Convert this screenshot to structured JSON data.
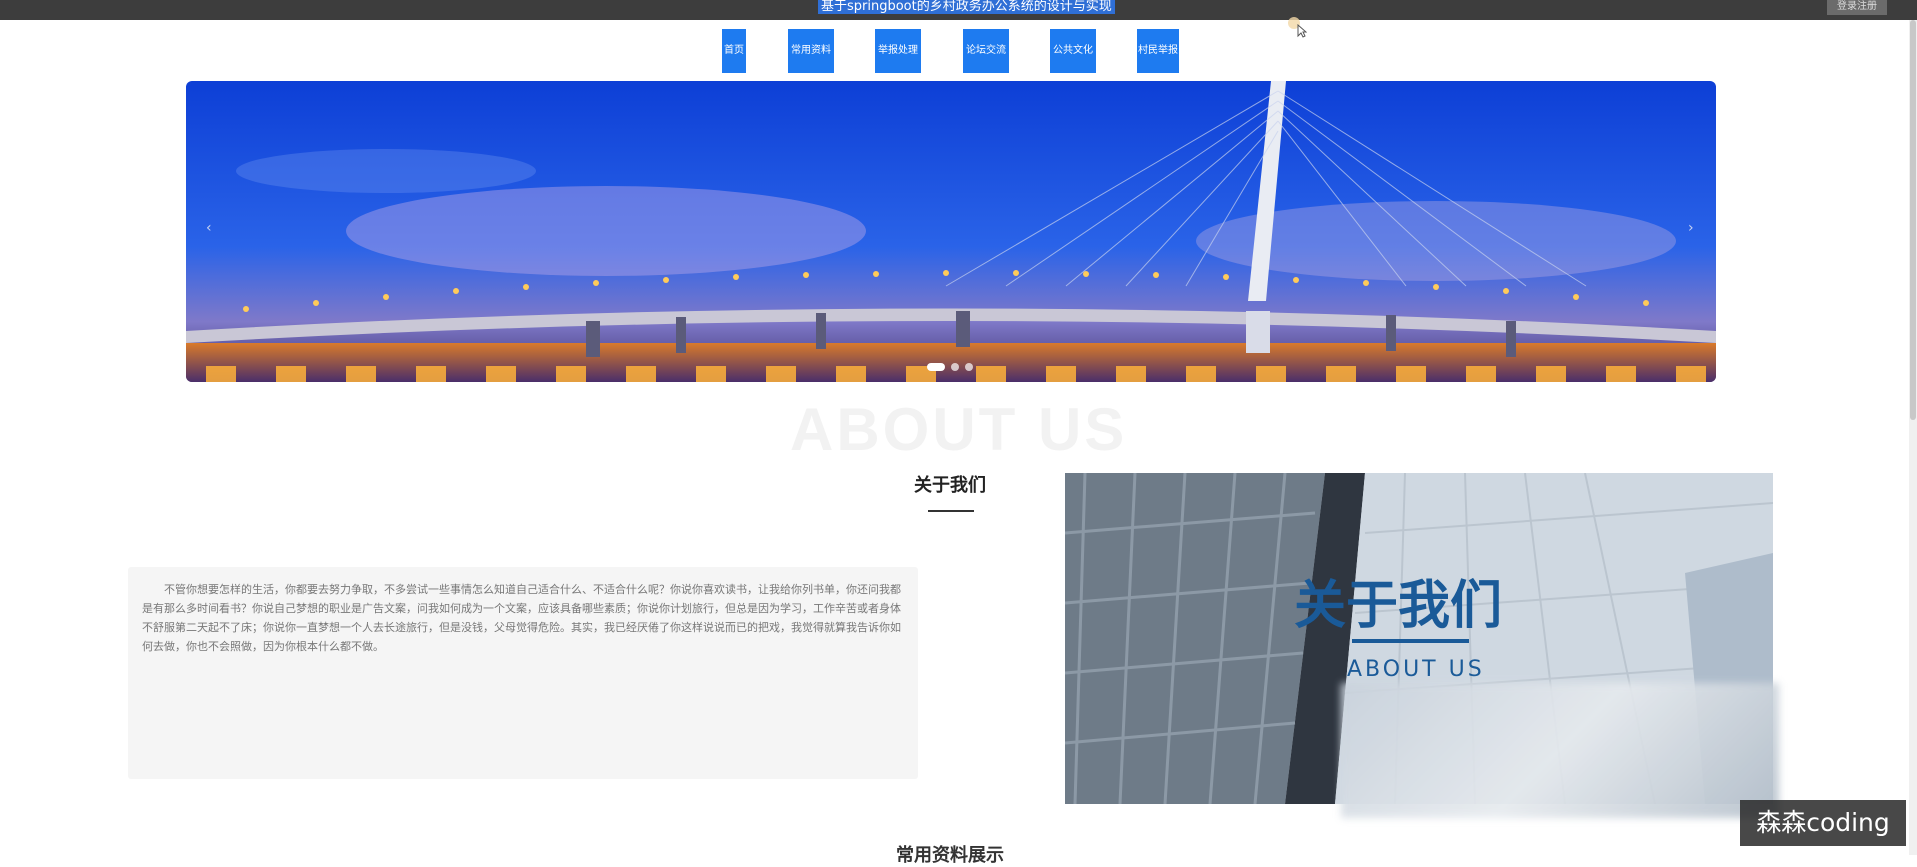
{
  "header": {
    "title": "基于springboot的乡村政务办公系统的设计与实现",
    "login_label": "登录注册"
  },
  "nav": {
    "items": [
      {
        "label": "首页"
      },
      {
        "label": "常用资料"
      },
      {
        "label": "举报处理"
      },
      {
        "label": "论坛交流"
      },
      {
        "label": "公共文化"
      },
      {
        "label": "村民举报"
      }
    ]
  },
  "carousel": {
    "prev_label": "‹",
    "next_label": "›",
    "slide_count": 3,
    "active_index": 0
  },
  "about": {
    "background_title": "ABOUT US",
    "title": "关于我们",
    "body": "不管你想要怎样的生活，你都要去努力争取，不多尝试一些事情怎么知道自己适合什么、不适合什么呢？你说你喜欢读书，让我给你列书单，你还问我都是有那么多时间看书？你说自己梦想的职业是广告文案，问我如何成为一个文案，应该具备哪些素质；你说你计划旅行，但总是因为学习，工作辛苦或者身体不舒服第二天起不了床；你说你一直梦想一个人去长途旅行，但是没钱，父母觉得危险。其实，我已经厌倦了你这样说说而已的把戏，我觉得就算我告诉你如何去做，你也不会照做，因为你根本什么都不做。",
    "image_title": "关于我们",
    "image_subtitle": "ABOUT US"
  },
  "next_section": {
    "title": "常用资料展示"
  },
  "watermark": "森森coding",
  "colors": {
    "nav_bg": "#1e7bf0",
    "title_highlight": "#2f6fd6",
    "topbar": "#3d3d3d"
  }
}
